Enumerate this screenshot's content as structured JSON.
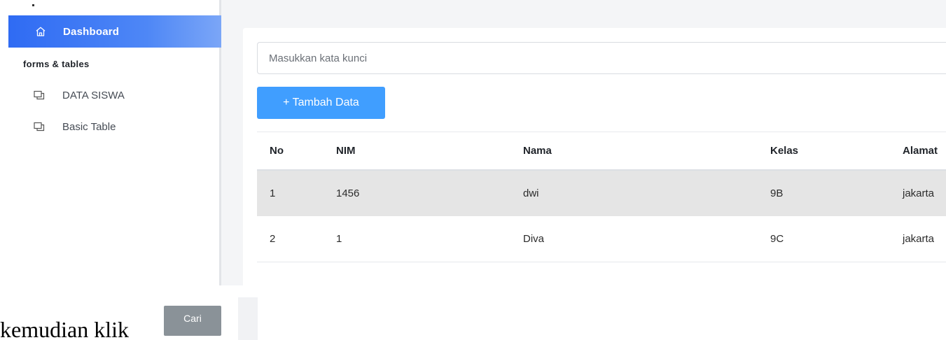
{
  "sidebar": {
    "active_item": {
      "label": "Dashboard",
      "icon": "home-icon"
    },
    "section_title": "forms & tables",
    "items": [
      {
        "label": "DATA SISWA",
        "icon": "window-icon"
      },
      {
        "label": "Basic Table",
        "icon": "window-icon"
      }
    ]
  },
  "main": {
    "search": {
      "placeholder": "Masukkan kata kunci",
      "value": ""
    },
    "add_button": "+ Tambah Data",
    "table": {
      "headers": [
        "No",
        "NIM",
        "Nama",
        "Kelas",
        "Alamat"
      ],
      "rows": [
        [
          "1",
          "1456",
          "dwi",
          "9B",
          "jakarta"
        ],
        [
          "2",
          "1",
          "Diva",
          "9C",
          "jakarta"
        ]
      ]
    }
  },
  "document": {
    "instruction": "kemudian klik",
    "cari_button": "Cari"
  },
  "colors": {
    "accent": "#409eff",
    "active_nav": "#2f6bf3",
    "cari_button": "#8a9298"
  }
}
